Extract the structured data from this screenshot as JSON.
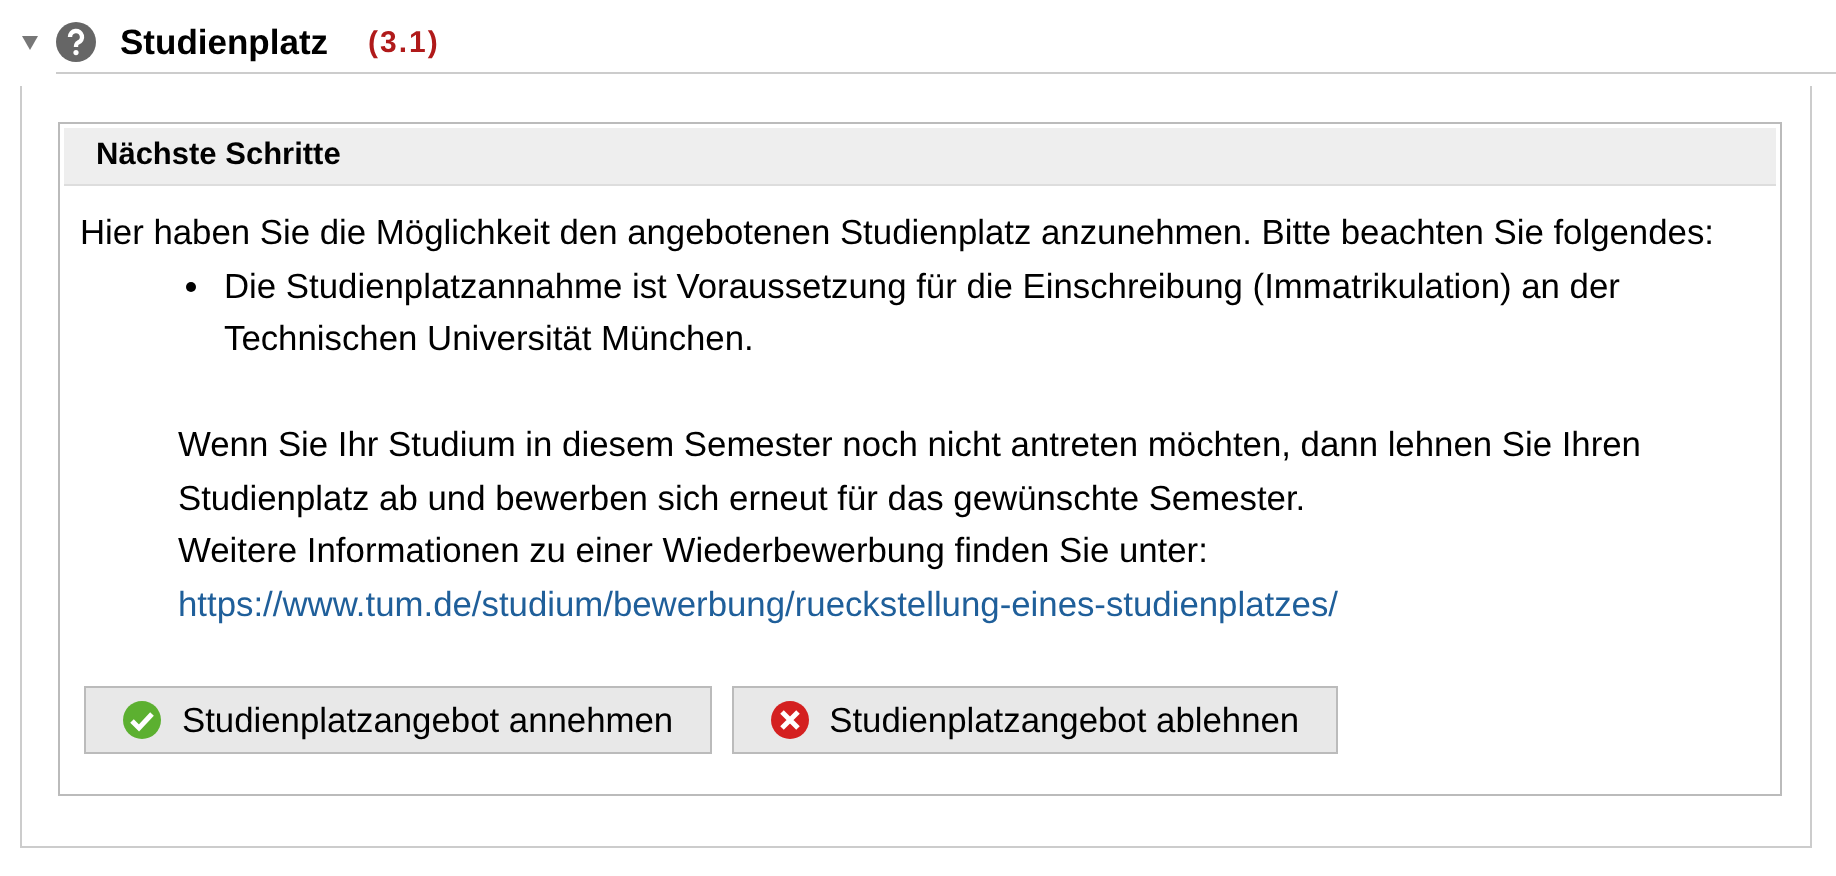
{
  "section": {
    "title": "Studienplatz",
    "number": "(3.1)",
    "expanded": true
  },
  "panel": {
    "title": "Nächste Schritte",
    "intro": "Hier haben Sie die Möglichkeit den angebotenen Studienplatz anzunehmen. Bitte beachten Sie folgendes:",
    "bullets": [
      "Die Studienplatzannahme ist Voraussetzung für die Einschreibung (Immatrikulation) an der Technischen Universität München."
    ],
    "paragraph": [
      "Wenn Sie Ihr Studium in diesem Semester noch nicht antreten möchten, dann lehnen Sie Ihren Studienplatz ab und bewerben sich erneut für das gewünschte Semester.",
      "Weitere Informationen zu einer Wiederbewerbung finden Sie unter:"
    ],
    "link": "https://www.tum.de/studium/bewerbung/rueckstellung-eines-studienplatzes/",
    "buttons": [
      {
        "kind": "accept",
        "label": "Studienplatzangebot annehmen"
      },
      {
        "kind": "decline",
        "label": "Studienplatzangebot ablehnen"
      }
    ]
  }
}
